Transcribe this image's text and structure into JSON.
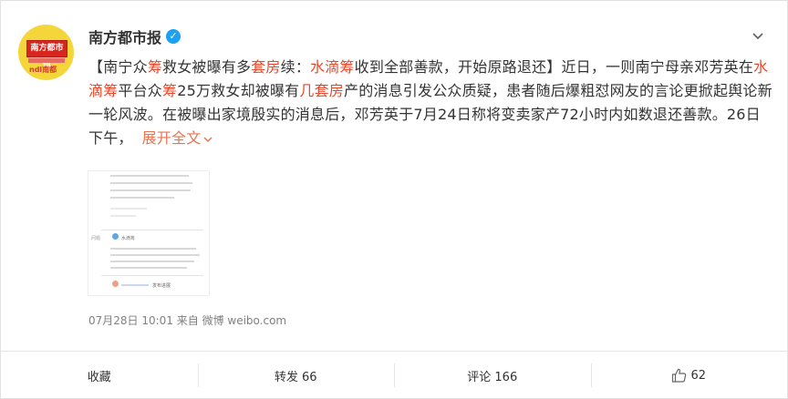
{
  "post": {
    "account_name": "南方都市报",
    "avatar_text": "南方都市报",
    "avatar_mark": "ndl南都",
    "text_segments": [
      {
        "t": "【南宁众",
        "c": "n"
      },
      {
        "t": "筹",
        "c": "hl"
      },
      {
        "t": "救女被曝有多",
        "c": "n"
      },
      {
        "t": "套房",
        "c": "hl"
      },
      {
        "t": "续：",
        "c": "n"
      },
      {
        "t": "水滴筹",
        "c": "hl"
      },
      {
        "t": "收到全部善款，开始原路退还】近日，一则南宁母亲邓芳英在",
        "c": "n"
      },
      {
        "t": "水滴筹",
        "c": "hl"
      },
      {
        "t": "平台众",
        "c": "n"
      },
      {
        "t": "筹",
        "c": "hl"
      },
      {
        "t": "25万救女却被曝有",
        "c": "n"
      },
      {
        "t": "几套房",
        "c": "hl"
      },
      {
        "t": "产的消息引发公众质疑，患者随后爆粗怼网友的言论更掀起舆论新一轮风波。在被曝出家境殷实的消息后，邓芳英于7月24日称将变卖家产72小时内如数退还善款。26日下午，",
        "c": "n"
      }
    ],
    "expand_label": "展开全文",
    "thumbnail_labels": {
      "row1": "问题",
      "row2": "水滴筹",
      "row3": "发布进展"
    },
    "timestamp": "07月28日 10:01",
    "source": "来自 微博 weibo.com"
  },
  "actions": {
    "favorite_label": "收藏",
    "repost_label": "转发 66",
    "comment_label": "评论 166",
    "like_count": "62"
  },
  "colors": {
    "highlight": "#e8482c",
    "link": "#eb7350",
    "verified": "#1da1f2"
  }
}
